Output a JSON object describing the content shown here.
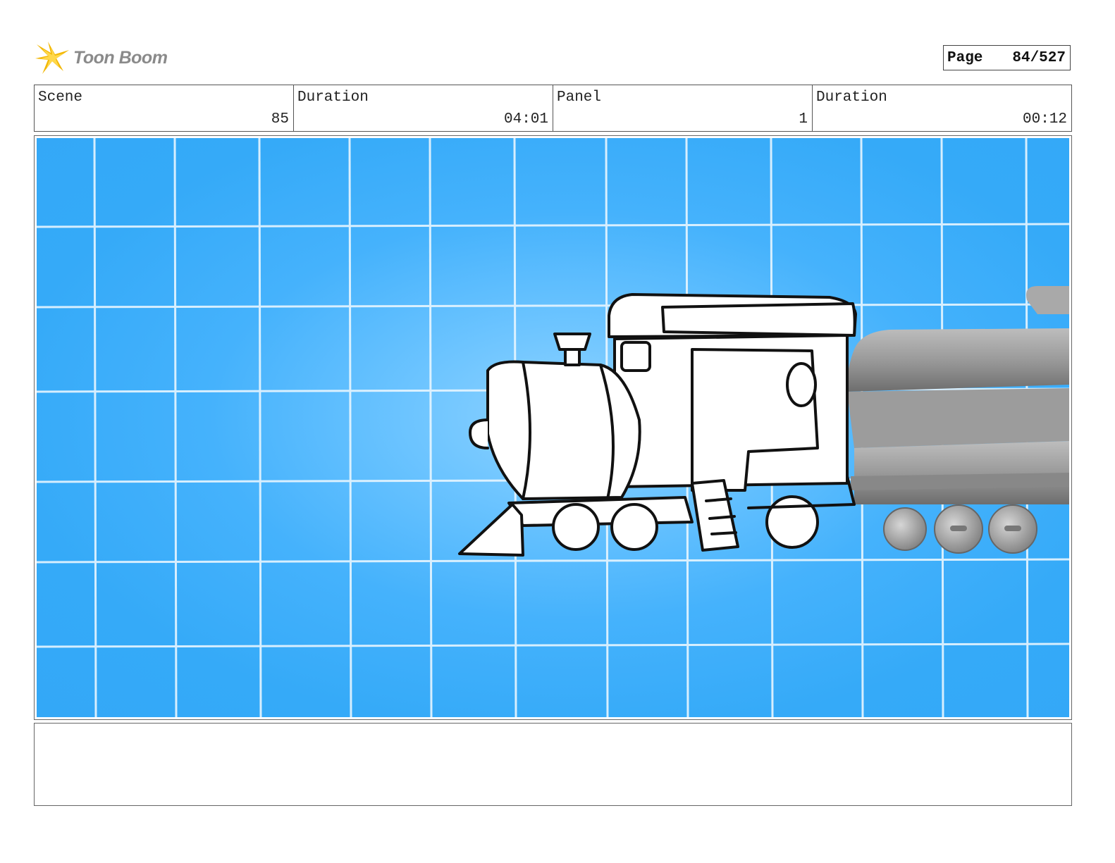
{
  "header": {
    "logo_text": "Toon Boom",
    "logo_icon": "toon-boom-star-icon",
    "page_label": "Page",
    "page_value": "84/527"
  },
  "info": {
    "scene_label": "Scene",
    "scene_value": "85",
    "scene_duration_label": "Duration",
    "scene_duration_value": "04:01",
    "panel_label": "Panel",
    "panel_value": "1",
    "panel_duration_label": "Duration",
    "panel_duration_value": "00:12"
  },
  "artwork": {
    "description_icons": [
      "sketched-locomotive",
      "3d-train-car"
    ],
    "background_color": "#33a8f7",
    "grid_color": "#e8f6ff"
  },
  "notes": {
    "text": ""
  }
}
